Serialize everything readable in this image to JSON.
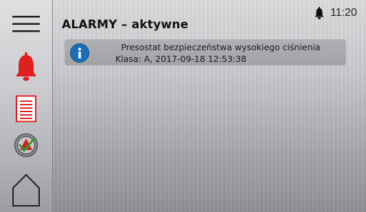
{
  "status": {
    "time": "11:20",
    "icon": "bell-icon"
  },
  "page": {
    "title": "ALARMY – aktywne"
  },
  "sidebar": {
    "items": [
      {
        "name": "menu",
        "icon": "hamburger-menu-icon"
      },
      {
        "name": "alarms",
        "icon": "alarm-bell-icon",
        "color": "#e02020"
      },
      {
        "name": "alarm-log",
        "icon": "document-list-icon",
        "color": "#e02020"
      },
      {
        "name": "acknowledge",
        "icon": "acknowledge-check-icon"
      },
      {
        "name": "home",
        "icon": "home-icon"
      }
    ]
  },
  "alarms": [
    {
      "icon": "info-icon",
      "message": "Presostat bezpieczeństwa wysokiego ciśnienia",
      "details": "Klasa: A, 2017-09-18 12:53:38"
    }
  ],
  "colors": {
    "accent_red": "#e02020",
    "info_blue": "#1a6fb7"
  }
}
